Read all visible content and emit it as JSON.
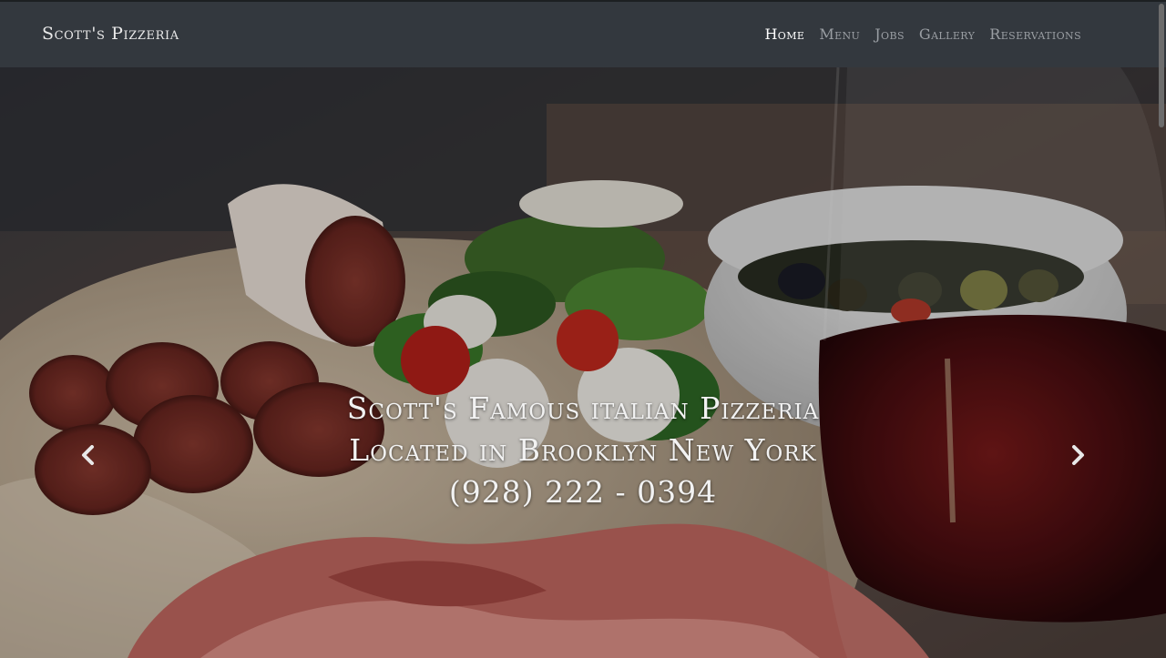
{
  "brand": "Scott's Pizzeria",
  "nav": {
    "items": [
      {
        "label": "Home",
        "active": true
      },
      {
        "label": "Menu",
        "active": false
      },
      {
        "label": "Jobs",
        "active": false
      },
      {
        "label": "Gallery",
        "active": false
      },
      {
        "label": "Reservations",
        "active": false
      }
    ]
  },
  "hero": {
    "caption": [
      "Scott's Famous italian Pizzeria",
      "Located in Brooklyn New York",
      "(928) 222 - 0394"
    ],
    "prev_icon": "chevron-left-icon",
    "next_icon": "chevron-right-icon"
  },
  "colors": {
    "navbar": "#33383e",
    "nav_active": "#ffffff",
    "nav_inactive": "#9a9ea3"
  }
}
